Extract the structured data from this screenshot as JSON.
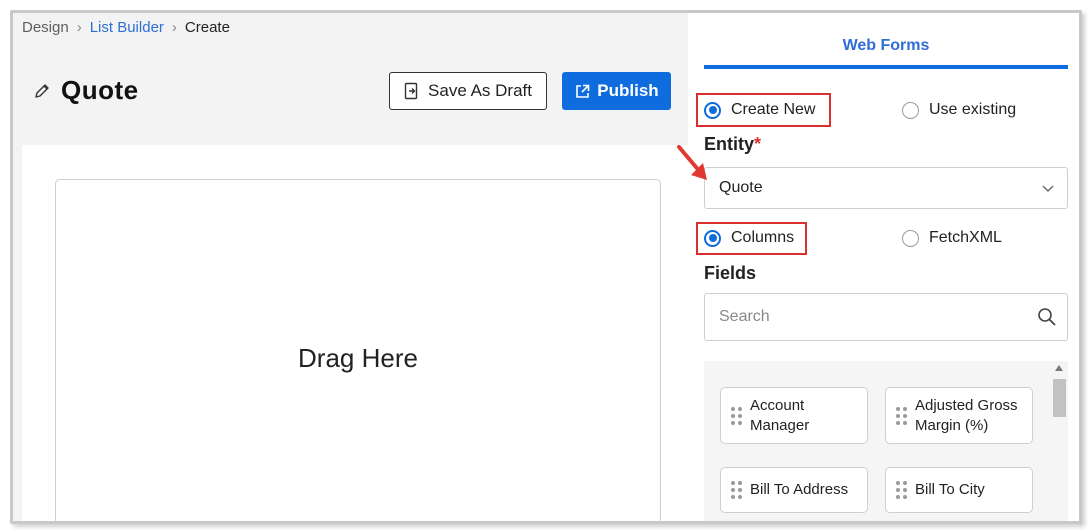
{
  "breadcrumb": {
    "root": "Design",
    "section": "List Builder",
    "current": "Create"
  },
  "header": {
    "title": "Quote",
    "save_draft_label": "Save As Draft",
    "publish_label": "Publish"
  },
  "canvas": {
    "drop_text": "Drag Here"
  },
  "panel": {
    "tab_label": "Web Forms",
    "mode_options": {
      "create_new": "Create New",
      "use_existing": "Use existing",
      "selected": "Create New"
    },
    "entity": {
      "label": "Entity",
      "required_mark": "*",
      "value": "Quote"
    },
    "source_options": {
      "columns": "Columns",
      "fetchxml": "FetchXML",
      "selected": "Columns"
    },
    "fields": {
      "label": "Fields",
      "search_placeholder": "Search",
      "items": [
        {
          "label_line1": "Account",
          "label_line2": "Manager"
        },
        {
          "label_line1": "Adjusted Gross",
          "label_line2": "Margin (%)"
        },
        {
          "label_line1": "Bill To Address",
          "label_line2": ""
        },
        {
          "label_line1": "Bill To City",
          "label_line2": ""
        }
      ]
    }
  },
  "colors": {
    "accent": "#0f6cde",
    "link": "#2f6ed6",
    "highlight": "#d9302c"
  }
}
